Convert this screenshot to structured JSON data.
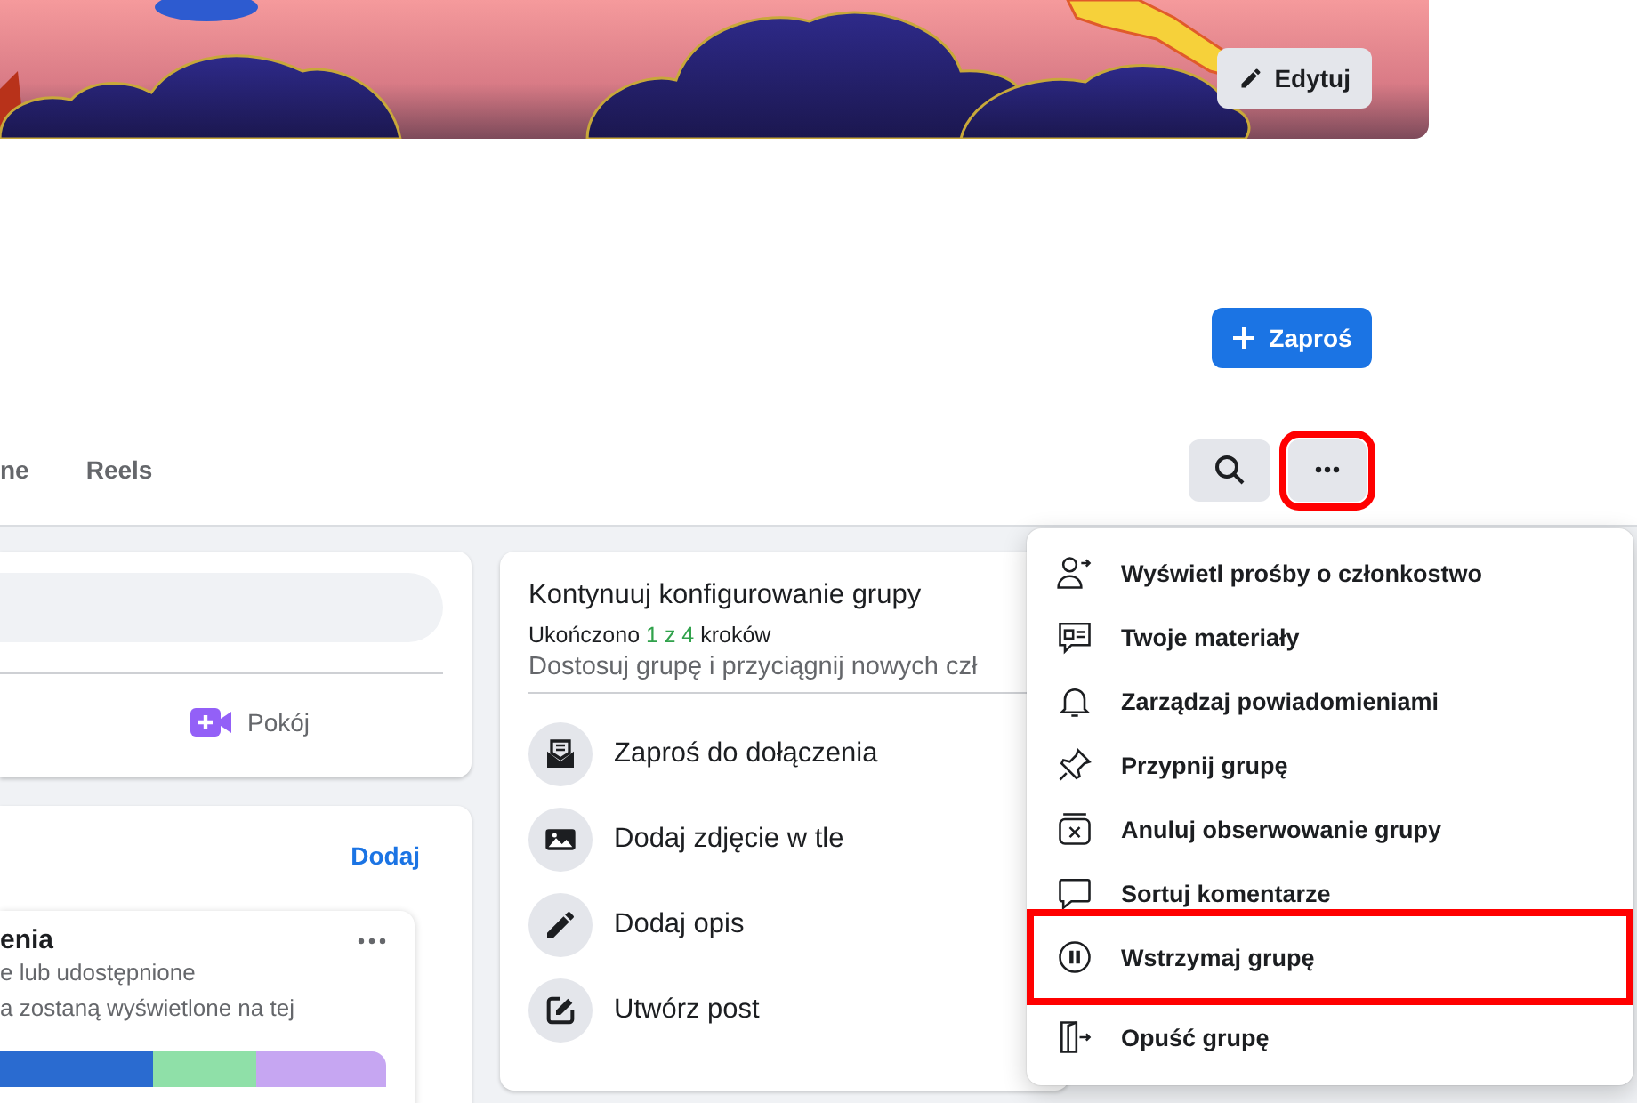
{
  "cover": {
    "edit_button": "Edytuj"
  },
  "invite_button": "Zaproś",
  "tabs": [
    {
      "label": "ne",
      "selected": false
    },
    {
      "label": "Reels",
      "selected": false
    }
  ],
  "toolbar": {
    "more_highlighted": true
  },
  "composer": {
    "room_button": "Pokój"
  },
  "featured": {
    "add_link": "Dodaj",
    "card": {
      "title": "enia",
      "lines": [
        "e lub udostępnione",
        "a zostaną wyświetlone na tej"
      ]
    }
  },
  "setup": {
    "title": "Kontynuuj konfigurowanie grupy",
    "progress": {
      "before": "Ukończono",
      "count": "1 z 4",
      "after": "kroków"
    },
    "description": "Dostosuj grupę i przyciągnij nowych czł",
    "steps": [
      {
        "kind": "invite",
        "label": "Zaproś do dołączenia"
      },
      {
        "kind": "photo",
        "label": "Dodaj zdjęcie w tle"
      },
      {
        "kind": "description",
        "label": "Dodaj opis"
      },
      {
        "kind": "post",
        "label": "Utwórz post"
      }
    ]
  },
  "menu": [
    {
      "kind": "requests",
      "label": "Wyświetl prośby o członkostwo",
      "highlighted": false
    },
    {
      "kind": "content",
      "label": "Twoje materiały",
      "highlighted": false
    },
    {
      "kind": "notifications",
      "label": "Zarządzaj powiadomieniami",
      "highlighted": false
    },
    {
      "kind": "pin",
      "label": "Przypnij grupę",
      "highlighted": false
    },
    {
      "kind": "unfollow",
      "label": "Anuluj obserwowanie grupy",
      "highlighted": false
    },
    {
      "kind": "sort",
      "label": "Sortuj komentarze",
      "highlighted": false
    },
    {
      "kind": "pause",
      "label": "Wstrzymaj grupę",
      "highlighted": true
    },
    {
      "kind": "leave",
      "label": "Opuść grupę",
      "highlighted": false
    }
  ]
}
